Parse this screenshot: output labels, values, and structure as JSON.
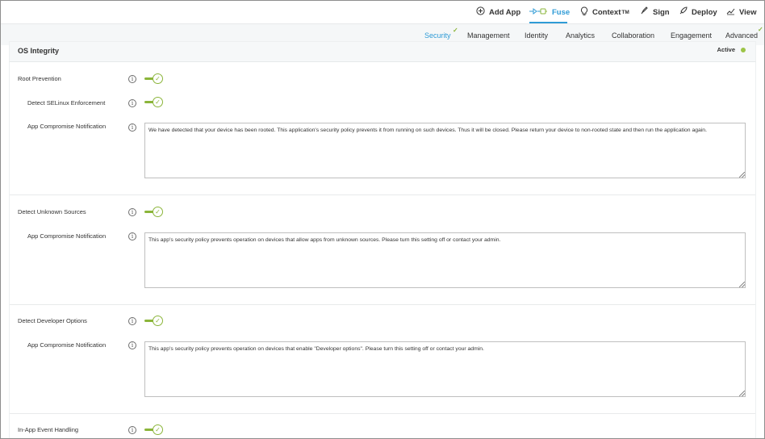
{
  "toolbar": {
    "add_app": "Add App",
    "fuse": "Fuse",
    "context": "Context",
    "context_tm": "TM",
    "sign": "Sign",
    "deploy": "Deploy",
    "view": "View"
  },
  "tabs": {
    "security": "Security",
    "management": "Management",
    "identity": "Identity",
    "analytics": "Analytics",
    "collaboration": "Collaboration",
    "engagement": "Engagement",
    "advanced": "Advanced"
  },
  "section": {
    "title": "OS Integrity",
    "status": "Active"
  },
  "settings": {
    "root_prevention": "Root Prevention",
    "detect_selinux": "Detect SELinux Enforcement",
    "root_notification_label": "App Compromise Notification",
    "root_notification_text": "We have detected that your device has been rooted. This application's security policy prevents it from running on such devices. Thus it will be closed. Please return your device to non-rooted state and then run the application again.",
    "unknown_sources": "Detect Unknown Sources",
    "unknown_notification_label": "App Compromise Notification",
    "unknown_notification_text": "This app's security policy prevents operation on devices that allow apps from unknown sources. Please turn this setting off or contact your admin.",
    "developer_options": "Detect Developer Options",
    "developer_notification_label": "App Compromise Notification",
    "developer_notification_text": "This app's security policy prevents operation on devices that enable \"Developer options\". Please turn this setting off or contact your admin.",
    "inapp_event": "In-App Event Handling"
  },
  "icons": {
    "info": "i",
    "check": "✓"
  },
  "colors": {
    "accent_blue": "#2f9bd6",
    "toggle_green": "#8bb53a",
    "active_dot": "#9cc447"
  }
}
